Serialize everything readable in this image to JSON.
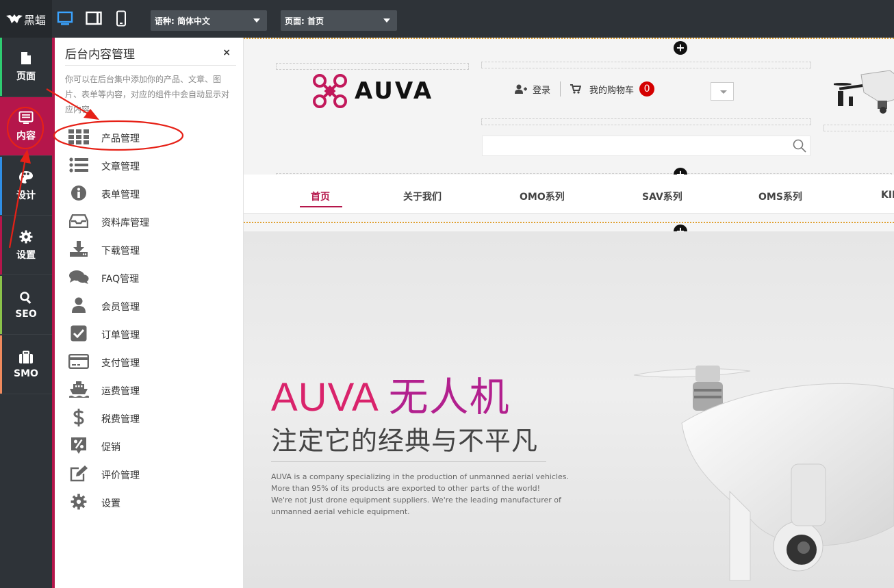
{
  "topbar": {
    "logo_text": "黑蝠",
    "device_buttons": [
      "desktop-icon",
      "tablet-icon",
      "phone-icon"
    ],
    "language_select": "语种: 简体中文",
    "page_select": "页面: 首页"
  },
  "rail": {
    "items": [
      {
        "label": "页面",
        "icon": "page-icon",
        "color": "#2ecc71"
      },
      {
        "label": "内容",
        "icon": "content-icon",
        "color": "#b5164b"
      },
      {
        "label": "设计",
        "icon": "palette-icon",
        "color": "#2f8fe6"
      },
      {
        "label": "设置",
        "icon": "gear-icon",
        "color": "#b5164b"
      },
      {
        "label": "SEO",
        "icon": "search-icon",
        "color": "#8bc34a"
      },
      {
        "label": "SMO",
        "icon": "briefcase-icon",
        "color": "#f08a5d"
      }
    ]
  },
  "panel": {
    "title": "后台内容管理",
    "close": "×",
    "description": "你可以在后台集中添加你的产品、文章、图片、表单等内容，对应的组件中会自动显示对应内容",
    "menu": [
      {
        "label": "产品管理",
        "icon": "grid-icon"
      },
      {
        "label": "文章管理",
        "icon": "list-icon"
      },
      {
        "label": "表单管理",
        "icon": "info-icon"
      },
      {
        "label": "资料库管理",
        "icon": "inbox-icon"
      },
      {
        "label": "下载管理",
        "icon": "download-icon"
      },
      {
        "label": "FAQ管理",
        "icon": "chat-icon"
      },
      {
        "label": "会员管理",
        "icon": "user-icon"
      },
      {
        "label": "订单管理",
        "icon": "checkbox-icon"
      },
      {
        "label": "支付管理",
        "icon": "credit-card-icon"
      },
      {
        "label": "运费管理",
        "icon": "ship-icon"
      },
      {
        "label": "税费管理",
        "icon": "dollar-icon"
      },
      {
        "label": "促销",
        "icon": "percent-icon"
      },
      {
        "label": "评价管理",
        "icon": "edit-icon"
      },
      {
        "label": "设置",
        "icon": "gear-icon"
      }
    ]
  },
  "site": {
    "brand": "AUVA",
    "login": "登录",
    "cart": "我的购物车",
    "cart_count": "0",
    "nav": [
      "首页",
      "关于我们",
      "OMO系列",
      "SAV系列",
      "OMS系列",
      "KIN"
    ],
    "hero_title_en": "AUVA",
    "hero_title_cn": "无人机",
    "hero_subtitle": "注定它的经典与不平凡",
    "hero_desc": [
      "AUVA is a company specializing in the production of unmanned aerial vehicles.",
      "More than 95% of its products are exported to other parts of the world!",
      "We're not just drone equipment suppliers. We're the leading manufacturer of",
      "unmanned aerial vehicle equipment."
    ]
  },
  "colors": {
    "accent": "#b5164b",
    "dark": "#2e3338",
    "annotation": "#e62117"
  }
}
